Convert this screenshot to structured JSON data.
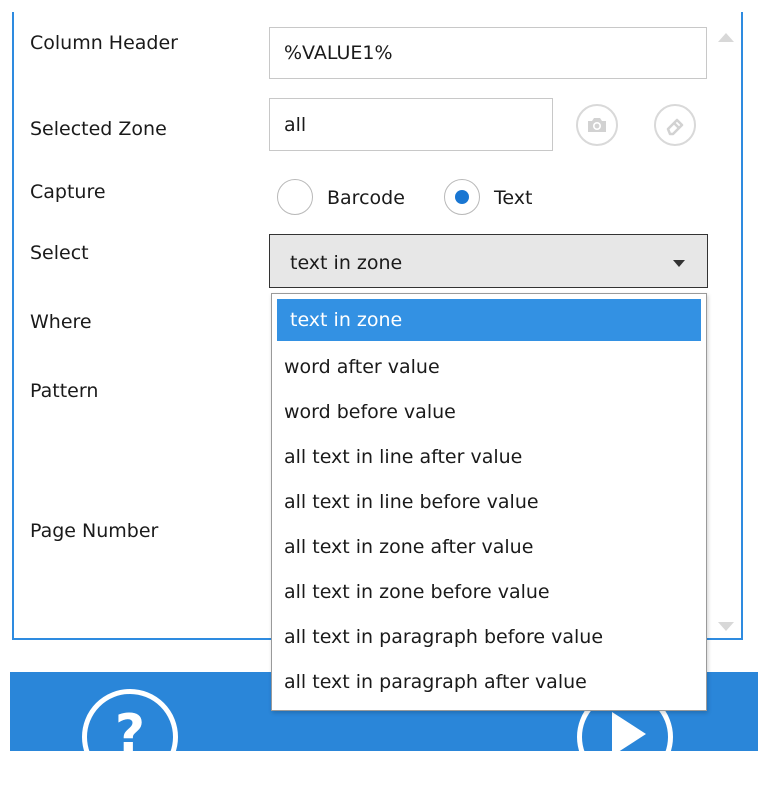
{
  "form": {
    "column_header_label": "Column Header",
    "column_header_value": "%VALUE1%",
    "selected_zone_label": "Selected Zone",
    "selected_zone_value": "all",
    "capture_label": "Capture",
    "capture_options": [
      "Barcode",
      "Text"
    ],
    "capture_selected": "Text",
    "select_label": "Select",
    "select_value": "text in zone",
    "where_label": "Where",
    "pattern_label": "Pattern",
    "page_number_label": "Page Number"
  },
  "dropdown": {
    "options": [
      "text in zone",
      "word after value",
      "word before value",
      "all text in line after value",
      "all text in line before value",
      "all text in zone after value",
      "all text in zone before value",
      "all text in paragraph before value",
      "all text in paragraph after value"
    ],
    "selected_index": 0
  },
  "icons": {
    "camera": "camera-icon",
    "eraser": "eraser-icon",
    "help": "help-icon",
    "play": "play-icon"
  },
  "colors": {
    "accent": "#2a86d9",
    "selected_option": "#3391e3",
    "radio_selected": "#1976d2"
  }
}
